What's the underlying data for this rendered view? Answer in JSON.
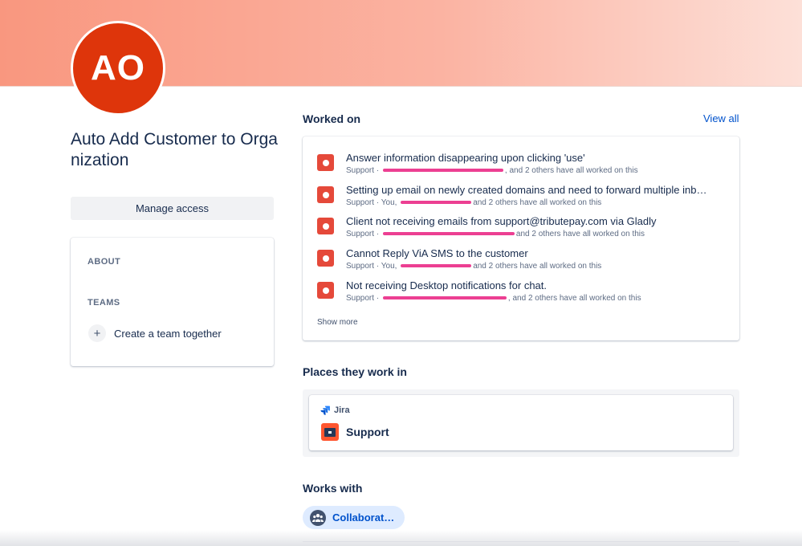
{
  "profile": {
    "avatar_initials": "AO",
    "name": "Auto Add Customer to Organization",
    "manage_access_label": "Manage access"
  },
  "about_card": {
    "about_label": "ABOUT",
    "teams_label": "TEAMS",
    "create_team_label": "Create a team together"
  },
  "worked_on": {
    "heading": "Worked on",
    "view_all_label": "View all",
    "show_more_label": "Show more",
    "items": [
      {
        "title": "Answer information disappearing upon clicking 'use'",
        "project": "Support",
        "contributors_text": ", and 2 others have all worked on this"
      },
      {
        "title": "Setting up email on newly created domains and need to forward multiple inb…",
        "project": "Support",
        "you_label": "You,",
        "contributors_text": "and 2 others have all worked on this"
      },
      {
        "title": "Client not receiving emails from support@tributepay.com via Gladly",
        "project": "Support",
        "contributors_text": "and 2 others have all worked on this"
      },
      {
        "title": "Cannot Reply ViA SMS to the customer",
        "project": "Support",
        "you_label": "You,",
        "contributors_text": "and 2 others have all worked on this"
      },
      {
        "title": "Not receiving Desktop notifications for chat.",
        "project": "Support",
        "contributors_text": ", and 2 others have all worked on this"
      }
    ]
  },
  "places": {
    "heading": "Places they work in",
    "product_label": "Jira",
    "project_name": "Support"
  },
  "works_with": {
    "heading": "Works with",
    "chip_label": "Collaborat…"
  },
  "colors": {
    "avatar_bg": "#de350b",
    "link_blue": "#0052cc",
    "issue_icon": "#e5493a",
    "chip_bg": "#deebff"
  }
}
